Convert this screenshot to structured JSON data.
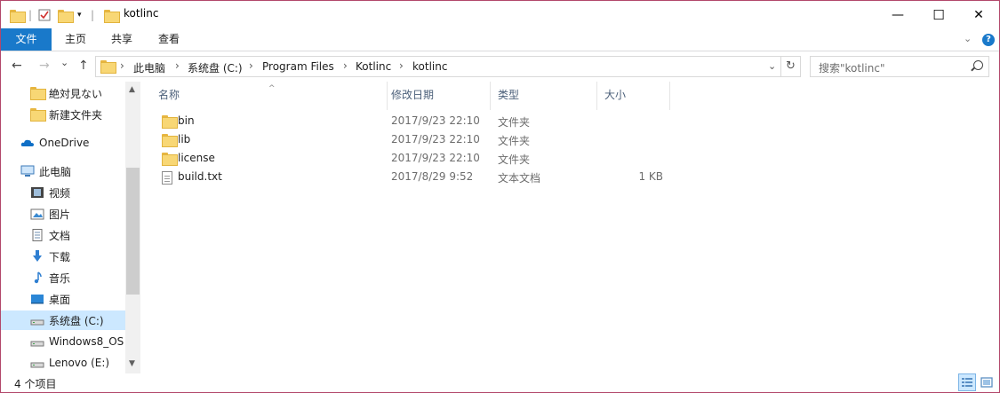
{
  "window": {
    "title": "kotlinc",
    "controls": {
      "minimize": "—",
      "maximize": "☐",
      "close": "✕"
    }
  },
  "ribbon": {
    "tabs": [
      "文件",
      "主页",
      "共享",
      "查看"
    ],
    "help": "?"
  },
  "nav": {
    "back": "←",
    "forward": "→",
    "recent": "⌄",
    "up": "↑"
  },
  "address": {
    "crumbs": [
      "此电脑",
      "系统盘 (C:)",
      "Program Files",
      "Kotlinc",
      "kotlinc"
    ],
    "separator": "›",
    "refresh": "↻"
  },
  "search": {
    "placeholder": "搜索\"kotlinc\""
  },
  "sidebar": {
    "items": [
      {
        "label": "絶対見ない",
        "icon": "folder-icon"
      },
      {
        "label": "新建文件夹",
        "icon": "folder-icon"
      },
      {
        "label": "OneDrive",
        "icon": "onedrive-icon"
      },
      {
        "label": "此电脑",
        "icon": "computer-icon"
      },
      {
        "label": "视频",
        "icon": "video-icon"
      },
      {
        "label": "图片",
        "icon": "pictures-icon"
      },
      {
        "label": "文档",
        "icon": "documents-icon"
      },
      {
        "label": "下载",
        "icon": "download-icon"
      },
      {
        "label": "音乐",
        "icon": "music-icon"
      },
      {
        "label": "桌面",
        "icon": "desktop-icon"
      },
      {
        "label": "系统盘 (C:)",
        "icon": "drive-icon",
        "selected": true
      },
      {
        "label": "Windows8_OS",
        "icon": "drive-icon"
      },
      {
        "label": "Lenovo (E:)",
        "icon": "drive-icon"
      }
    ]
  },
  "filelist": {
    "columns": [
      "名称",
      "修改日期",
      "类型",
      "大小"
    ],
    "rows": [
      {
        "name": "bin",
        "date": "2017/9/23 22:10",
        "type": "文件夹",
        "size": "",
        "icon": "folder-icon"
      },
      {
        "name": "lib",
        "date": "2017/9/23 22:10",
        "type": "文件夹",
        "size": "",
        "icon": "folder-icon"
      },
      {
        "name": "license",
        "date": "2017/9/23 22:10",
        "type": "文件夹",
        "size": "",
        "icon": "folder-icon"
      },
      {
        "name": "build.txt",
        "date": "2017/8/29 9:52",
        "type": "文本文档",
        "size": "1 KB",
        "icon": "text-file-icon"
      }
    ]
  },
  "status": {
    "count": "4 个项目"
  },
  "colors": {
    "accent": "#1979ca",
    "selection": "#cce8ff",
    "folder": "#f8d775",
    "border": "#b2476b"
  }
}
